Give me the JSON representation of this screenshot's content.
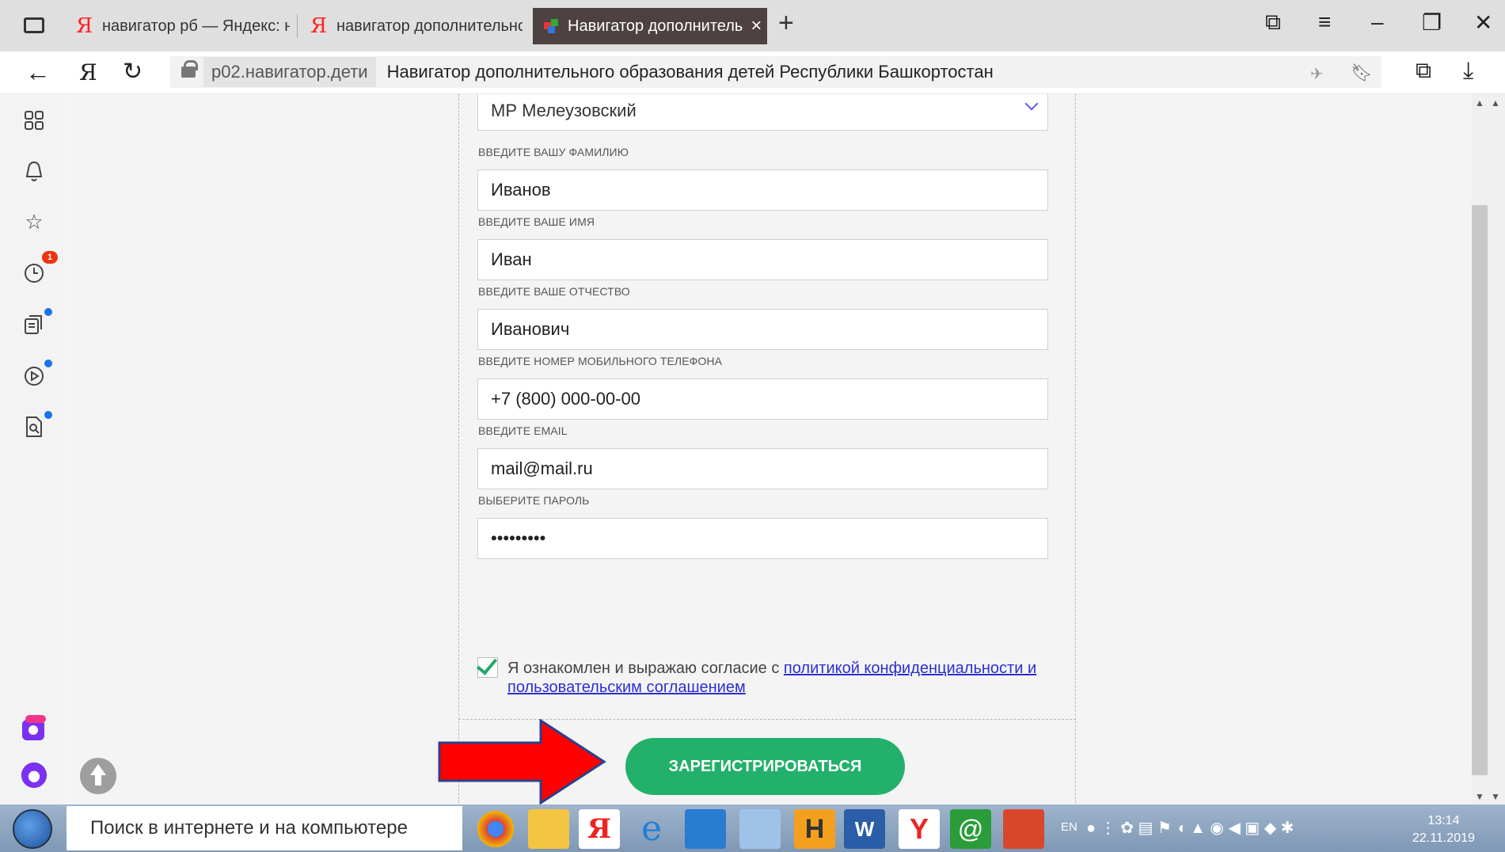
{
  "browser": {
    "tabs": [
      {
        "title": "навигатор рб — Яндекс: на"
      },
      {
        "title": "навигатор дополнительно"
      },
      {
        "title": "Навигатор дополнитель",
        "active": true
      }
    ],
    "domain": "р02.навигатор.дети",
    "page_title": "Навигатор дополнительного образования детей Республики Башкортостан",
    "notification_count": "1"
  },
  "form": {
    "municipality_value": "МР Мелеузовский",
    "fields": [
      {
        "label": "ВВЕДИТЕ ВАШУ ФАМИЛИЮ",
        "value": "Иванов"
      },
      {
        "label": "ВВЕДИТЕ ВАШЕ ИМЯ",
        "value": "Иван"
      },
      {
        "label": "ВВЕДИТЕ ВАШЕ ОТЧЕСТВО",
        "value": "Иванович"
      },
      {
        "label": "ВВЕДИТЕ НОМЕР МОБИЛЬНОГО ТЕЛЕФОНА",
        "value": "+7 (800) 000-00-00"
      },
      {
        "label": "ВВЕДИТЕ EMAIL",
        "value": "mail@mail.ru"
      },
      {
        "label": "ВЫБЕРИТЕ ПАРОЛЬ",
        "value": "•••••••••"
      }
    ],
    "agree_text": "Я ознакомлен и выражаю согласие с ",
    "agree_link": "политикой конфиденциальности и пользовательским соглашением",
    "submit_label": "ЗАРЕГИСТРИРОВАТЬСЯ"
  },
  "taskbar": {
    "search_placeholder": "Поиск в интернете и на компьютере",
    "lang": "EN",
    "time": "13:14",
    "date": "22.11.2019"
  },
  "colors": {
    "accent_green": "#22b06a",
    "link": "#2b2fd0",
    "arrow_red": "#ff0000"
  }
}
